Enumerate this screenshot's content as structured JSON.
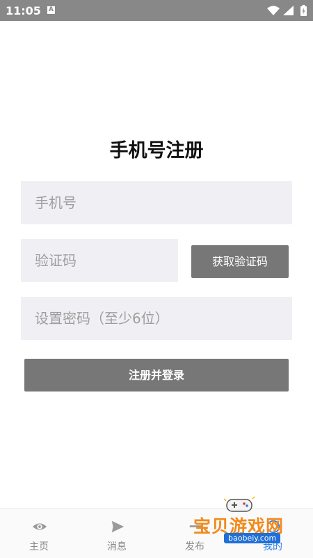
{
  "status_bar": {
    "time": "11:05",
    "notification_icon": "A"
  },
  "page": {
    "title": "手机号注册"
  },
  "form": {
    "phone_placeholder": "手机号",
    "code_placeholder": "验证码",
    "get_code_label": "获取验证码",
    "password_placeholder": "设置密码（至少6位）",
    "register_label": "注册并登录"
  },
  "tabbar": {
    "items": [
      {
        "label": "主页",
        "icon": "eye-icon"
      },
      {
        "label": "消息",
        "icon": "send-icon"
      },
      {
        "label": "发布",
        "icon": "publish-icon"
      },
      {
        "label": "我的",
        "icon": "profile-icon",
        "active": true
      }
    ],
    "active_color": "#2b7de9"
  },
  "watermark": {
    "text": "宝贝游戏网",
    "url": "baobeiy.com"
  },
  "colors": {
    "status_bar": "#888888",
    "button": "#777777",
    "field_bg": "#f0f0f4"
  }
}
